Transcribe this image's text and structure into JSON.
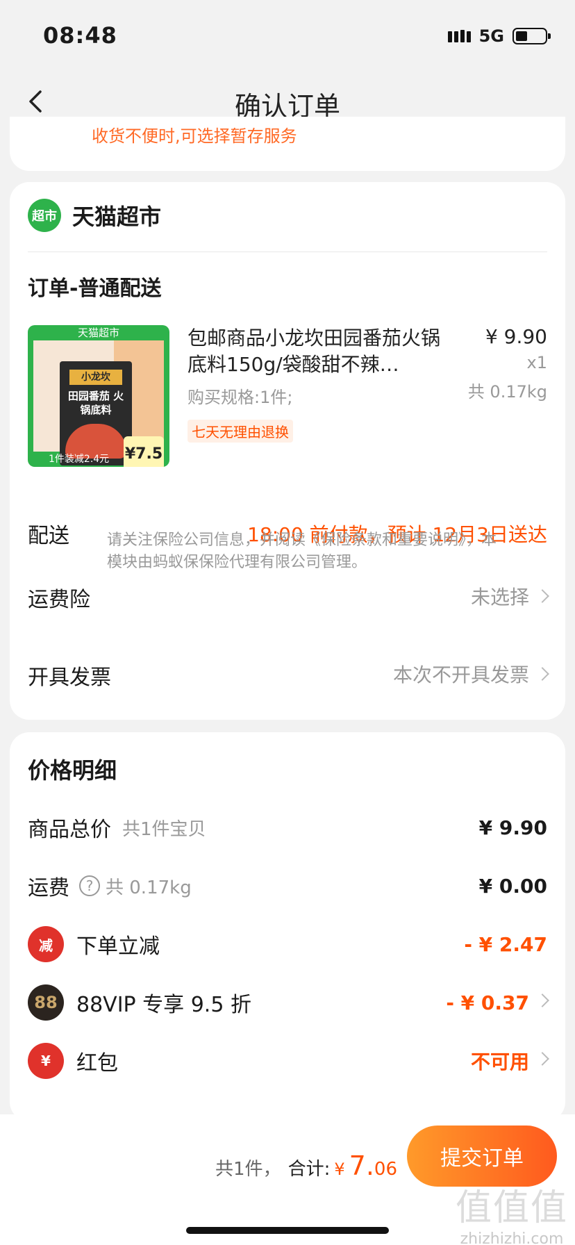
{
  "status": {
    "time": "08:48",
    "network": "5G"
  },
  "nav": {
    "title": "确认订单"
  },
  "top_card": {
    "cut_text": "收货不便时,可选择暂存服务"
  },
  "shop": {
    "logo_text": "超市",
    "name": "天猫超市"
  },
  "order": {
    "section": "订单-普通配送",
    "product": {
      "image_top": "天猫超市",
      "image_brand": "小龙坎",
      "image_name": "田园番茄 火锅底料",
      "image_bottom": "1件装减2.4元",
      "image_price": "¥7.5",
      "title": "包邮商品小龙坎田园番茄火锅底料150g/袋酸甜不辣…",
      "spec": "购买规格:1件;",
      "tag": "七天无理由退换",
      "price": "¥ 9.90",
      "qty": "x1",
      "weight": "共 0.17kg"
    },
    "delivery": {
      "label": "配送",
      "value": "18:00 前付款，预计 12月3日送达"
    },
    "insurance": {
      "label": "运费险",
      "value": "未选择",
      "note": "请关注保险公司信息，并阅读《保险条款和重要说明》，本模块由蚂蚁保保险代理有限公司管理。"
    },
    "invoice": {
      "label": "开具发票",
      "value": "本次不开具发票"
    }
  },
  "price_detail": {
    "title": "价格明细",
    "goods_total": {
      "label": "商品总价",
      "sub": "共1件宝贝",
      "value": "¥ 9.90"
    },
    "shipping": {
      "label": "运费",
      "sub": "共 0.17kg",
      "value": "¥ 0.00"
    },
    "discount": {
      "icon": "减",
      "label": "下单立减",
      "value": "- ¥ 2.47"
    },
    "vip": {
      "icon": "88",
      "label": "88VIP 专享 9.5 折",
      "value": "- ¥ 0.37"
    },
    "redpacket": {
      "icon": "¥",
      "label": "红包",
      "value": "不可用"
    }
  },
  "bottom": {
    "count": "共1件，",
    "total_label": "合计:",
    "currency": "¥",
    "amount_int": "7.",
    "amount_dec": "06",
    "submit": "提交订单",
    "watermark_big": "值值值",
    "watermark_small": "zhizhizhi.com"
  },
  "colors": {
    "accent": "#ff5000",
    "shop_green": "#2eb24b"
  }
}
